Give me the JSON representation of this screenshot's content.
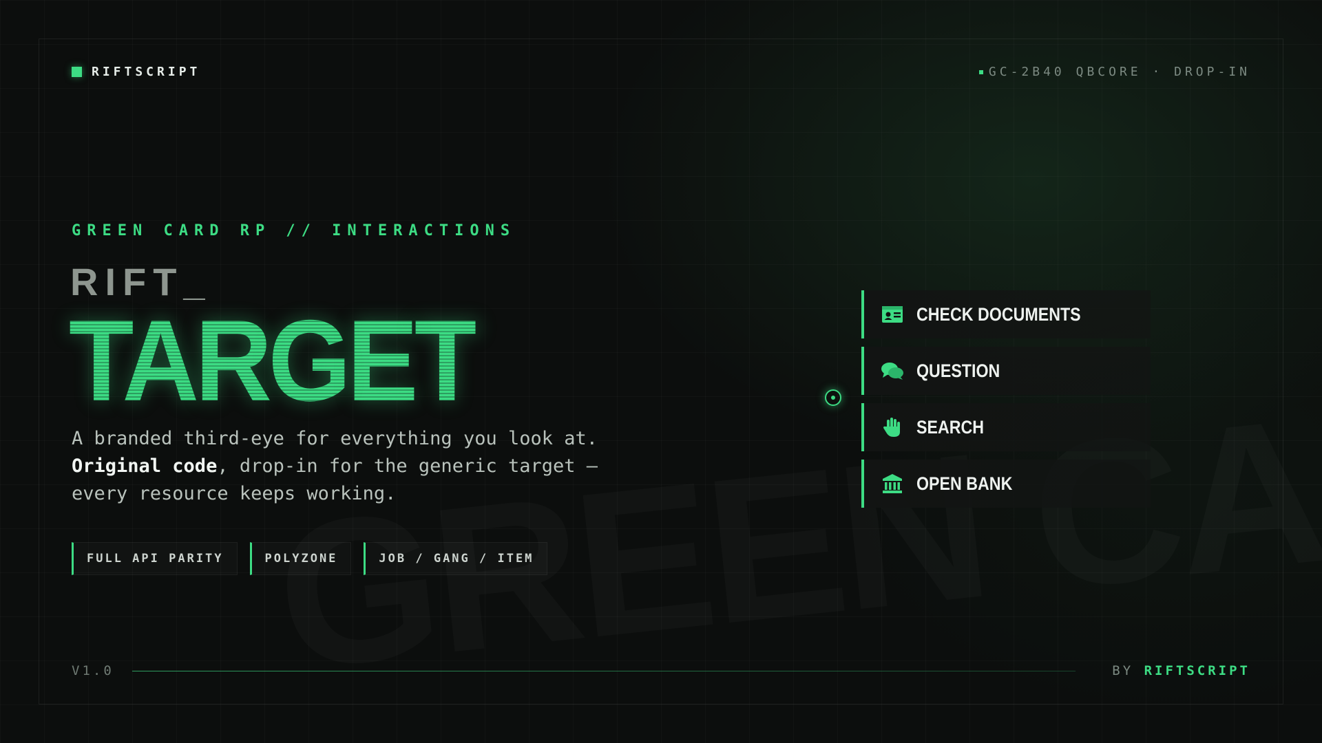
{
  "brand": {
    "name": "RIFTSCRIPT"
  },
  "meta": {
    "text": "GC-2B40 QBCORE · DROP-IN"
  },
  "hero": {
    "eyebrow": "GREEN CARD RP // INTERACTIONS",
    "title_small": "RIFT_",
    "title_big": "TARGET",
    "desc_part1": "A branded third-eye for everything you look at. ",
    "desc_bold": "Original code",
    "desc_part2": ", drop-in for the generic target — every resource keeps working."
  },
  "tags": [
    "FULL API PARITY",
    "POLYZONE",
    "JOB / GANG / ITEM"
  ],
  "menu": {
    "items": [
      {
        "label": "CHECK DOCUMENTS",
        "icon": "id-card-icon"
      },
      {
        "label": "QUESTION",
        "icon": "chat-bubbles-icon"
      },
      {
        "label": "SEARCH",
        "icon": "hand-icon"
      },
      {
        "label": "OPEN BANK",
        "icon": "bank-icon"
      }
    ]
  },
  "watermark": "GREEN CARD",
  "footer": {
    "version": "V1.0",
    "by_label": "BY",
    "by_name": "RIFTSCRIPT"
  },
  "colors": {
    "accent": "#3ddc84",
    "background": "#0c0e0d"
  }
}
